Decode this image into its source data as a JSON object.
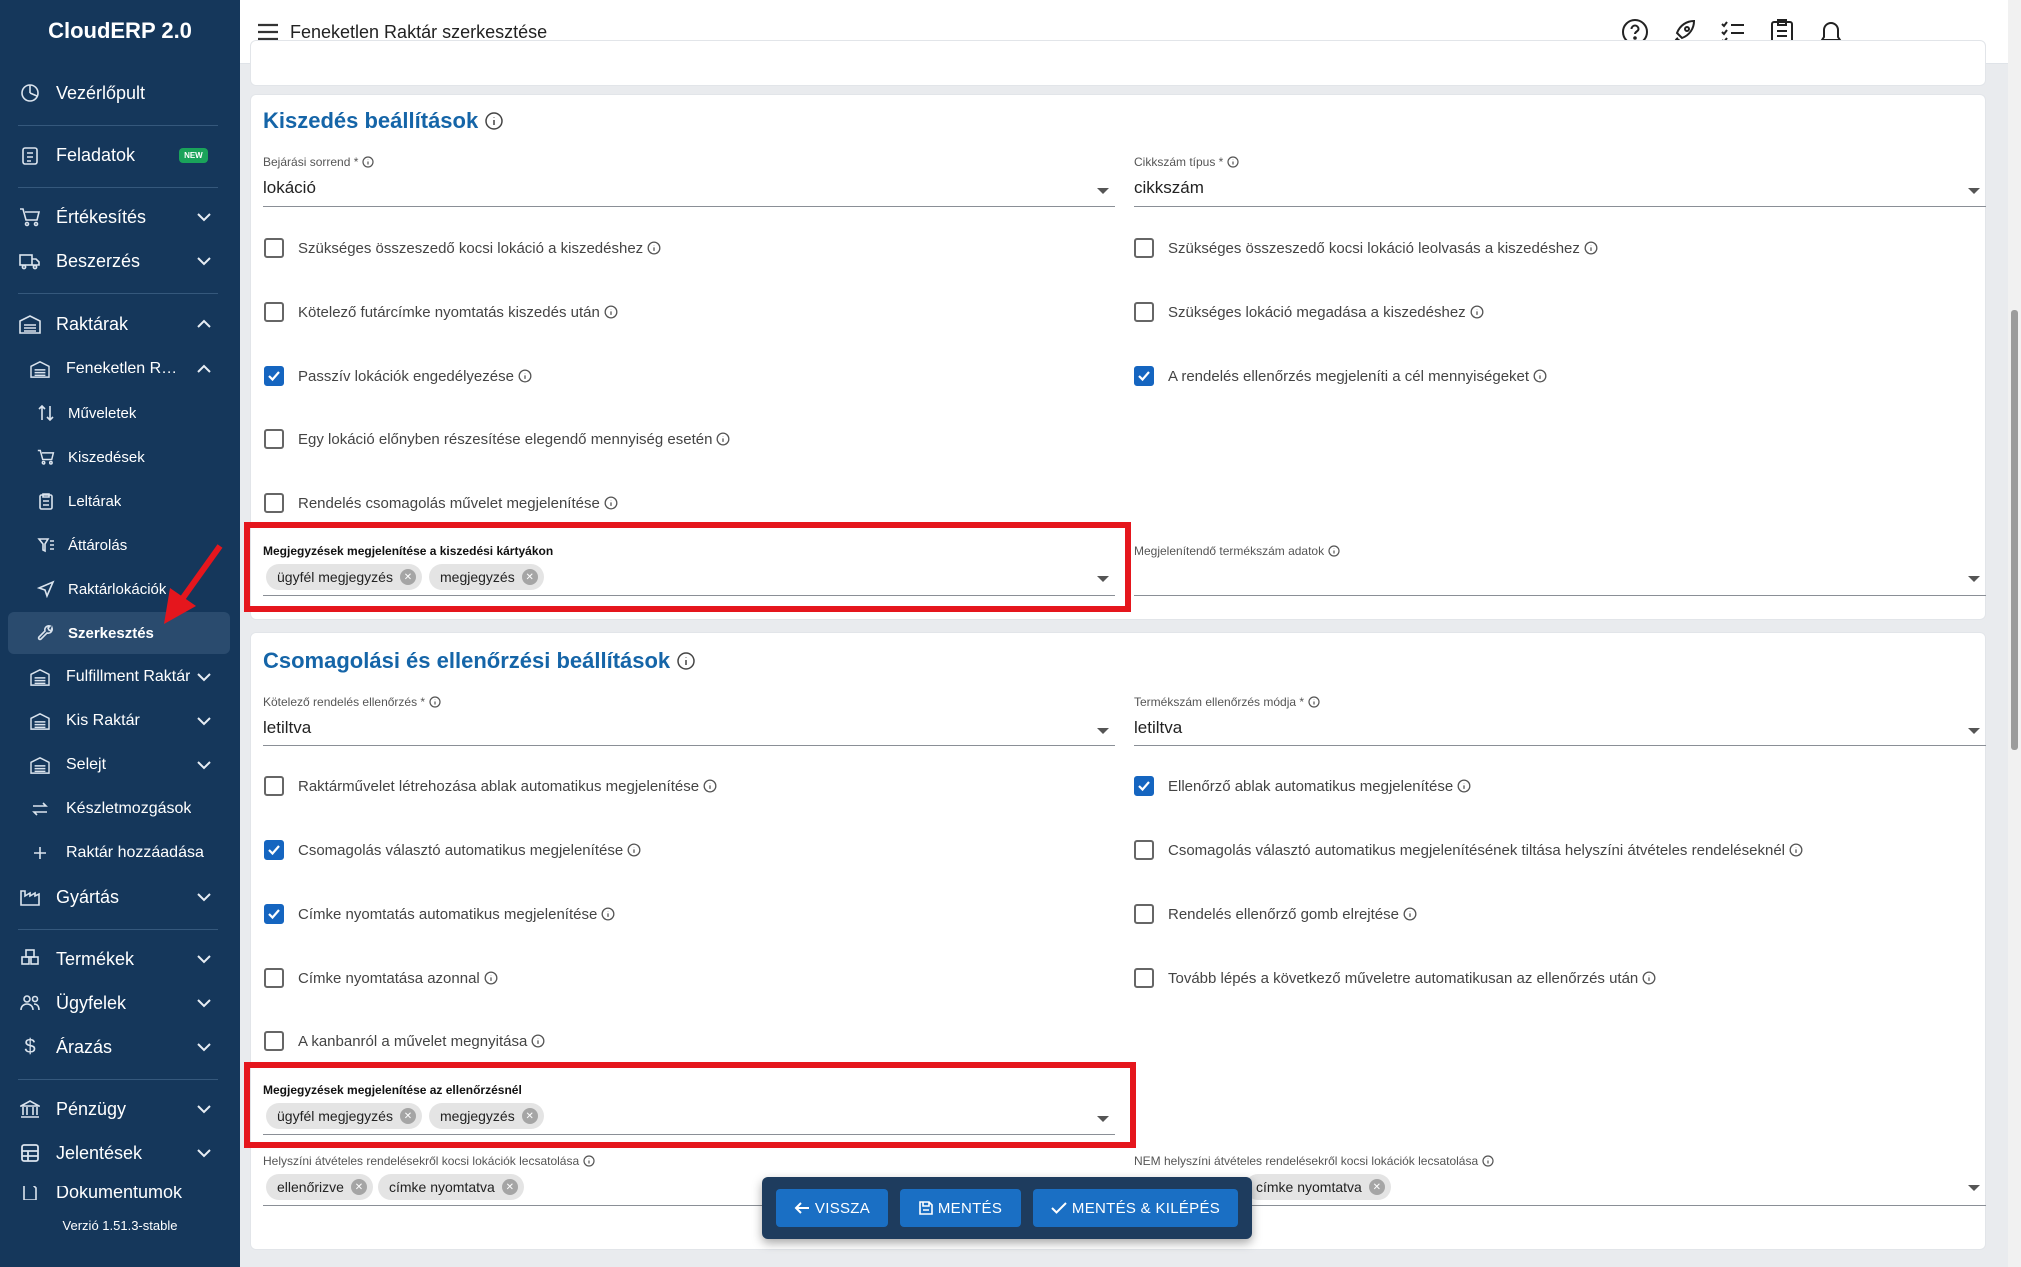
{
  "app": {
    "brand": "CloudERP 2.0",
    "version": "Verzió 1.51.3-stable"
  },
  "sidebar": {
    "items": [
      {
        "label": "Vezérlőpult",
        "icon": "dashboard-icon"
      },
      {
        "label": "Feladatok",
        "icon": "tasks-icon",
        "badge": "NEW"
      },
      {
        "label": "Értékesítés",
        "icon": "cart-icon"
      },
      {
        "label": "Beszerzés",
        "icon": "truck-icon"
      },
      {
        "label": "Raktárak",
        "icon": "warehouse-icon"
      },
      {
        "label": "Feneketlen Raktár",
        "icon": "warehouse-icon"
      },
      {
        "label": "Műveletek",
        "icon": "sort-icon"
      },
      {
        "label": "Kiszedések",
        "icon": "cart-icon"
      },
      {
        "label": "Leltárak",
        "icon": "clipboard-icon"
      },
      {
        "label": "Áttárolás",
        "icon": "filter-icon"
      },
      {
        "label": "Raktárlokációk",
        "icon": "location-icon"
      },
      {
        "label": "Szerkesztés",
        "icon": "wrench-icon"
      },
      {
        "label": "Fulfillment Raktár",
        "icon": "warehouse-icon"
      },
      {
        "label": "Kis Raktár",
        "icon": "warehouse-icon"
      },
      {
        "label": "Selejt",
        "icon": "warehouse-icon"
      },
      {
        "label": "Készletmozgások",
        "icon": "swap-icon"
      },
      {
        "label": "Raktár hozzáadása",
        "icon": "plus-icon"
      },
      {
        "label": "Gyártás",
        "icon": "factory-icon"
      },
      {
        "label": "Termékek",
        "icon": "products-icon"
      },
      {
        "label": "Ügyfelek",
        "icon": "users-icon"
      },
      {
        "label": "Árazás",
        "icon": "dollar-icon"
      },
      {
        "label": "Pénzügy",
        "icon": "bank-icon"
      },
      {
        "label": "Jelentések",
        "icon": "table-icon"
      },
      {
        "label": "Dokumentumok",
        "icon": "document-icon"
      }
    ]
  },
  "header": {
    "title": "Feneketlen Raktár szerkesztése"
  },
  "picking": {
    "title": "Kiszedés beállítások",
    "order_label": "Bejárási sorrend *",
    "order_value": "lokáció",
    "sku_type_label": "Cikkszám típus *",
    "sku_type_value": "cikkszám",
    "checkboxes": [
      {
        "label": "Szükséges összeszedő kocsi lokáció a kiszedéshez",
        "checked": false
      },
      {
        "label": "Szükséges összeszedő kocsi lokáció leolvasás a kiszedéshez",
        "checked": false
      },
      {
        "label": "Kötelező futárcímke nyomtatás kiszedés után",
        "checked": false
      },
      {
        "label": "Szükséges lokáció megadása a kiszedéshez",
        "checked": false
      },
      {
        "label": "Passzív lokációk engedélyezése",
        "checked": true
      },
      {
        "label": "A rendelés ellenőrzés megjeleníti a cél mennyiségeket",
        "checked": true
      },
      {
        "label": "Egy lokáció előnyben részesítése elegendő mennyiség esetén",
        "checked": false
      },
      {
        "label": "Rendelés csomagolás művelet megjelenítése",
        "checked": false
      }
    ],
    "notes_label": "Megjegyzések megjelenítése a kiszedési kártyákon",
    "notes_chips": [
      "ügyfél megjegyzés",
      "megjegyzés"
    ],
    "product_data_label": "Megjelenítendő termékszám adatok"
  },
  "packing": {
    "title": "Csomagolási és ellenőrzési beállítások",
    "check_label": "Kötelező rendelés ellenőrzés *",
    "check_value": "letiltva",
    "sku_check_label": "Termékszám ellenőrzés módja *",
    "sku_check_value": "letiltva",
    "checkboxes": [
      {
        "label": "Raktárművelet létrehozása ablak automatikus megjelenítése",
        "checked": false
      },
      {
        "label": "Ellenőrző ablak automatikus megjelenítése",
        "checked": true
      },
      {
        "label": "Csomagolás választó automatikus megjelenítése",
        "checked": true
      },
      {
        "label": "Csomagolás választó automatikus megjelenítésének tiltása helyszíni átvételes rendeléseknél",
        "checked": false
      },
      {
        "label": "Címke nyomtatás automatikus megjelenítése",
        "checked": true
      },
      {
        "label": "Rendelés ellenőrző gomb elrejtése",
        "checked": false
      },
      {
        "label": "Címke nyomtatása azonnal",
        "checked": false
      },
      {
        "label": "Tovább lépés a következő műveletre automatikusan az ellenőrzés után",
        "checked": false
      },
      {
        "label": "A kanbanról a művelet megnyitása",
        "checked": false
      }
    ],
    "notes_label": "Megjegyzések megjelenítése az ellenőrzésnél",
    "notes_chips": [
      "ügyfél megjegyzés",
      "megjegyzés"
    ],
    "pickup_label": "Helyszíni átvételes rendelésekről kocsi lokációk lecsatolása",
    "pickup_chips": [
      "ellenőrizve",
      "címke nyomtatva"
    ],
    "not_pickup_label": "NEM helyszíni átvételes rendelésekről kocsi lokációk lecsatolása",
    "not_pickup_chips": [
      "címke nyomtatva"
    ]
  },
  "actions": {
    "back": "VISSZA",
    "save": "MENTÉS",
    "save_exit": "MENTÉS & KILÉPÉS"
  },
  "colors": {
    "sidebar": "#15375b",
    "accent": "#1565a8",
    "highlight": "#e5161d"
  }
}
